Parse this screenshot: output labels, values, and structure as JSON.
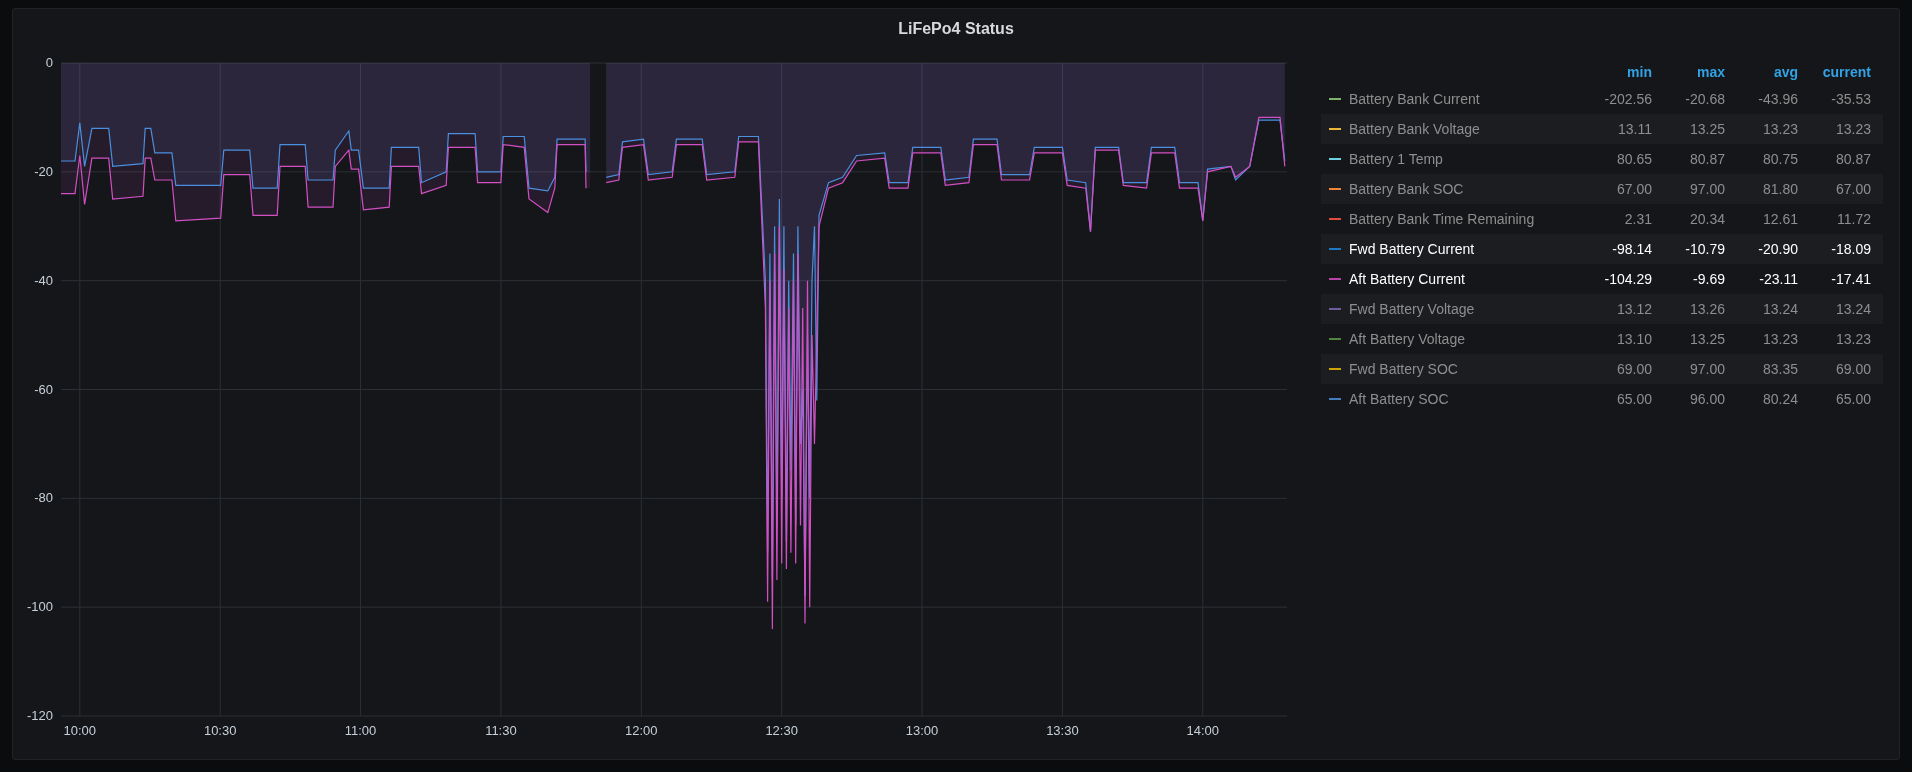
{
  "panel": {
    "title": "LiFePo4 Status"
  },
  "chart": {
    "chart_data": {
      "type": "area",
      "grid": true,
      "ylim": [
        -120,
        0
      ],
      "xlim": [
        9.933,
        14.3
      ],
      "yticks": [
        0,
        -20,
        -40,
        -60,
        -80,
        -100,
        -120
      ],
      "xticks": [
        {
          "value": 10,
          "label": "10:00"
        },
        {
          "value": 10.5,
          "label": "10:30"
        },
        {
          "value": 11,
          "label": "11:00"
        },
        {
          "value": 11.5,
          "label": "11:30"
        },
        {
          "value": 12,
          "label": "12:00"
        },
        {
          "value": 12.5,
          "label": "12:30"
        },
        {
          "value": 13,
          "label": "13:00"
        },
        {
          "value": 13.5,
          "label": "13:30"
        },
        {
          "value": 14,
          "label": "14:00"
        }
      ],
      "x": [
        9.933,
        9.983,
        10,
        10.017,
        10.043,
        10.103,
        10.117,
        10.225,
        10.233,
        10.253,
        10.267,
        10.328,
        10.342,
        10.502,
        10.513,
        10.605,
        10.617,
        10.703,
        10.713,
        10.803,
        10.813,
        10.902,
        10.91,
        10.958,
        10.967,
        10.993,
        11.01,
        11.102,
        11.11,
        11.207,
        11.217,
        11.305,
        11.313,
        11.408,
        11.417,
        11.5,
        11.508,
        11.583,
        11.6,
        11.667,
        11.692,
        11.7,
        11.8,
        11.803,
        11.833,
        11.875,
        11.92,
        11.933,
        12.008,
        12.025,
        12.11,
        12.125,
        12.217,
        12.233,
        12.333,
        12.347,
        12.417,
        12.442,
        12.45,
        12.458,
        12.467,
        12.475,
        12.483,
        12.492,
        12.5,
        12.508,
        12.517,
        12.525,
        12.533,
        12.542,
        12.55,
        12.558,
        12.567,
        12.575,
        12.583,
        12.592,
        12.6,
        12.608,
        12.617,
        12.625,
        12.633,
        12.667,
        12.717,
        12.767,
        12.867,
        12.883,
        12.95,
        12.967,
        13.067,
        13.083,
        13.167,
        13.183,
        13.267,
        13.283,
        13.383,
        13.4,
        13.5,
        13.517,
        13.583,
        13.6,
        13.617,
        13.7,
        13.717,
        13.8,
        13.817,
        13.9,
        13.917,
        13.983,
        14,
        14.017,
        14.1,
        14.117,
        14.167,
        14.2,
        14.275,
        14.292
      ],
      "series": [
        {
          "color": "#4a8fe0",
          "values": [
            -18,
            -18,
            -11,
            -19,
            -12,
            -12,
            -19,
            -18.5,
            -12,
            -12,
            -16.5,
            -16.5,
            -22.5,
            -22.5,
            -16,
            -16,
            -23,
            -23,
            -15,
            -15,
            -21.5,
            -21.5,
            -16,
            -12.5,
            -16,
            -16,
            -23,
            -23,
            -15.5,
            -15.5,
            -22,
            -20,
            -13,
            -13,
            -20,
            -20,
            -13.5,
            -13.5,
            -23,
            -23.5,
            -21,
            -14,
            -14,
            -20,
            null,
            -21,
            -20.5,
            -14.5,
            -14,
            -20.5,
            -20,
            -14,
            -14,
            -20.5,
            -20,
            -13.5,
            -13.5,
            -40,
            -90,
            -35,
            -95,
            -30,
            -85,
            -25,
            -80,
            -30,
            -88,
            -40,
            -75,
            -35,
            -85,
            -30,
            -70,
            -60,
            -98,
            -50,
            -80,
            -40,
            -30,
            -62,
            -28,
            -22,
            -21,
            -17,
            -16.5,
            -22,
            -22,
            -15.5,
            -15.5,
            -21.5,
            -21,
            -14,
            -14,
            -20.5,
            -20.5,
            -15.5,
            -15.5,
            -21.5,
            -22,
            -31,
            -15.5,
            -15.5,
            -22,
            -22,
            -15.5,
            -15.5,
            -22,
            -22,
            -29,
            -19.5,
            -19,
            -21.5,
            -19,
            -10.5,
            -10.5,
            -18
          ]
        },
        {
          "color": "#d24fc4",
          "values": [
            -24,
            -24,
            -17,
            -26,
            -17.5,
            -17.5,
            -25,
            -24.5,
            -17.5,
            -17.5,
            -21.5,
            -21.5,
            -29,
            -28.5,
            -20.5,
            -20.5,
            -28,
            -28,
            -19,
            -19,
            -26.5,
            -26.5,
            -19,
            -16,
            -19.5,
            -19.5,
            -27,
            -26.5,
            -19,
            -19,
            -24,
            -22.5,
            -15.5,
            -15.5,
            -22,
            -22,
            -15,
            -15.5,
            -25,
            -27.5,
            -23,
            -15,
            -15,
            -23,
            null,
            -22,
            -21.5,
            -15.5,
            -15,
            -21.5,
            -21,
            -15,
            -15,
            -21.5,
            -21,
            -14.5,
            -14.5,
            -45,
            -99,
            -40,
            -104,
            -35,
            -95,
            -30,
            -92,
            -38,
            -93,
            -45,
            -90,
            -40,
            -92,
            -35,
            -85,
            -45,
            -103,
            -40,
            -100,
            -50,
            -70,
            -50,
            -30,
            -23,
            -22,
            -18,
            -17.5,
            -23,
            -23,
            -16.5,
            -16.5,
            -22.5,
            -22,
            -15,
            -15,
            -21.5,
            -21.5,
            -16.5,
            -16.5,
            -22.5,
            -23,
            -31,
            -16,
            -16,
            -22.5,
            -23,
            -16.5,
            -16.5,
            -23,
            -23,
            -29,
            -20,
            -19,
            -21,
            -19,
            -10,
            -10,
            -19
          ]
        }
      ]
    }
  },
  "legend": {
    "columns": [
      "min",
      "max",
      "avg",
      "current"
    ],
    "rows": [
      {
        "name": "Battery Bank Current",
        "color": "#7eb26d",
        "hidden": true,
        "min": "-202.56",
        "max": "-20.68",
        "avg": "-43.96",
        "current": "-35.53"
      },
      {
        "name": "Battery Bank Voltage",
        "color": "#eab839",
        "hidden": true,
        "min": "13.11",
        "max": "13.25",
        "avg": "13.23",
        "current": "13.23"
      },
      {
        "name": "Battery 1 Temp",
        "color": "#6ed0e0",
        "hidden": true,
        "min": "80.65",
        "max": "80.87",
        "avg": "80.75",
        "current": "80.87"
      },
      {
        "name": "Battery Bank SOC",
        "color": "#ef843c",
        "hidden": true,
        "min": "67.00",
        "max": "97.00",
        "avg": "81.80",
        "current": "67.00"
      },
      {
        "name": "Battery Bank Time Remaining",
        "color": "#e24d42",
        "hidden": true,
        "min": "2.31",
        "max": "20.34",
        "avg": "12.61",
        "current": "11.72"
      },
      {
        "name": "Fwd Battery Current",
        "color": "#1f78c1",
        "hidden": false,
        "min": "-98.14",
        "max": "-10.79",
        "avg": "-20.90",
        "current": "-18.09"
      },
      {
        "name": "Aft Battery Current",
        "color": "#ba43a9",
        "hidden": false,
        "min": "-104.29",
        "max": "-9.69",
        "avg": "-23.11",
        "current": "-17.41"
      },
      {
        "name": "Fwd Battery Voltage",
        "color": "#705da0",
        "hidden": true,
        "min": "13.12",
        "max": "13.26",
        "avg": "13.24",
        "current": "13.24"
      },
      {
        "name": "Aft Battery Voltage",
        "color": "#508642",
        "hidden": true,
        "min": "13.10",
        "max": "13.25",
        "avg": "13.23",
        "current": "13.23"
      },
      {
        "name": "Fwd Battery SOC",
        "color": "#cca300",
        "hidden": true,
        "min": "69.00",
        "max": "97.00",
        "avg": "83.35",
        "current": "69.00"
      },
      {
        "name": "Aft Battery SOC",
        "color": "#447ebc",
        "hidden": true,
        "min": "65.00",
        "max": "96.00",
        "avg": "80.24",
        "current": "65.00"
      }
    ]
  }
}
